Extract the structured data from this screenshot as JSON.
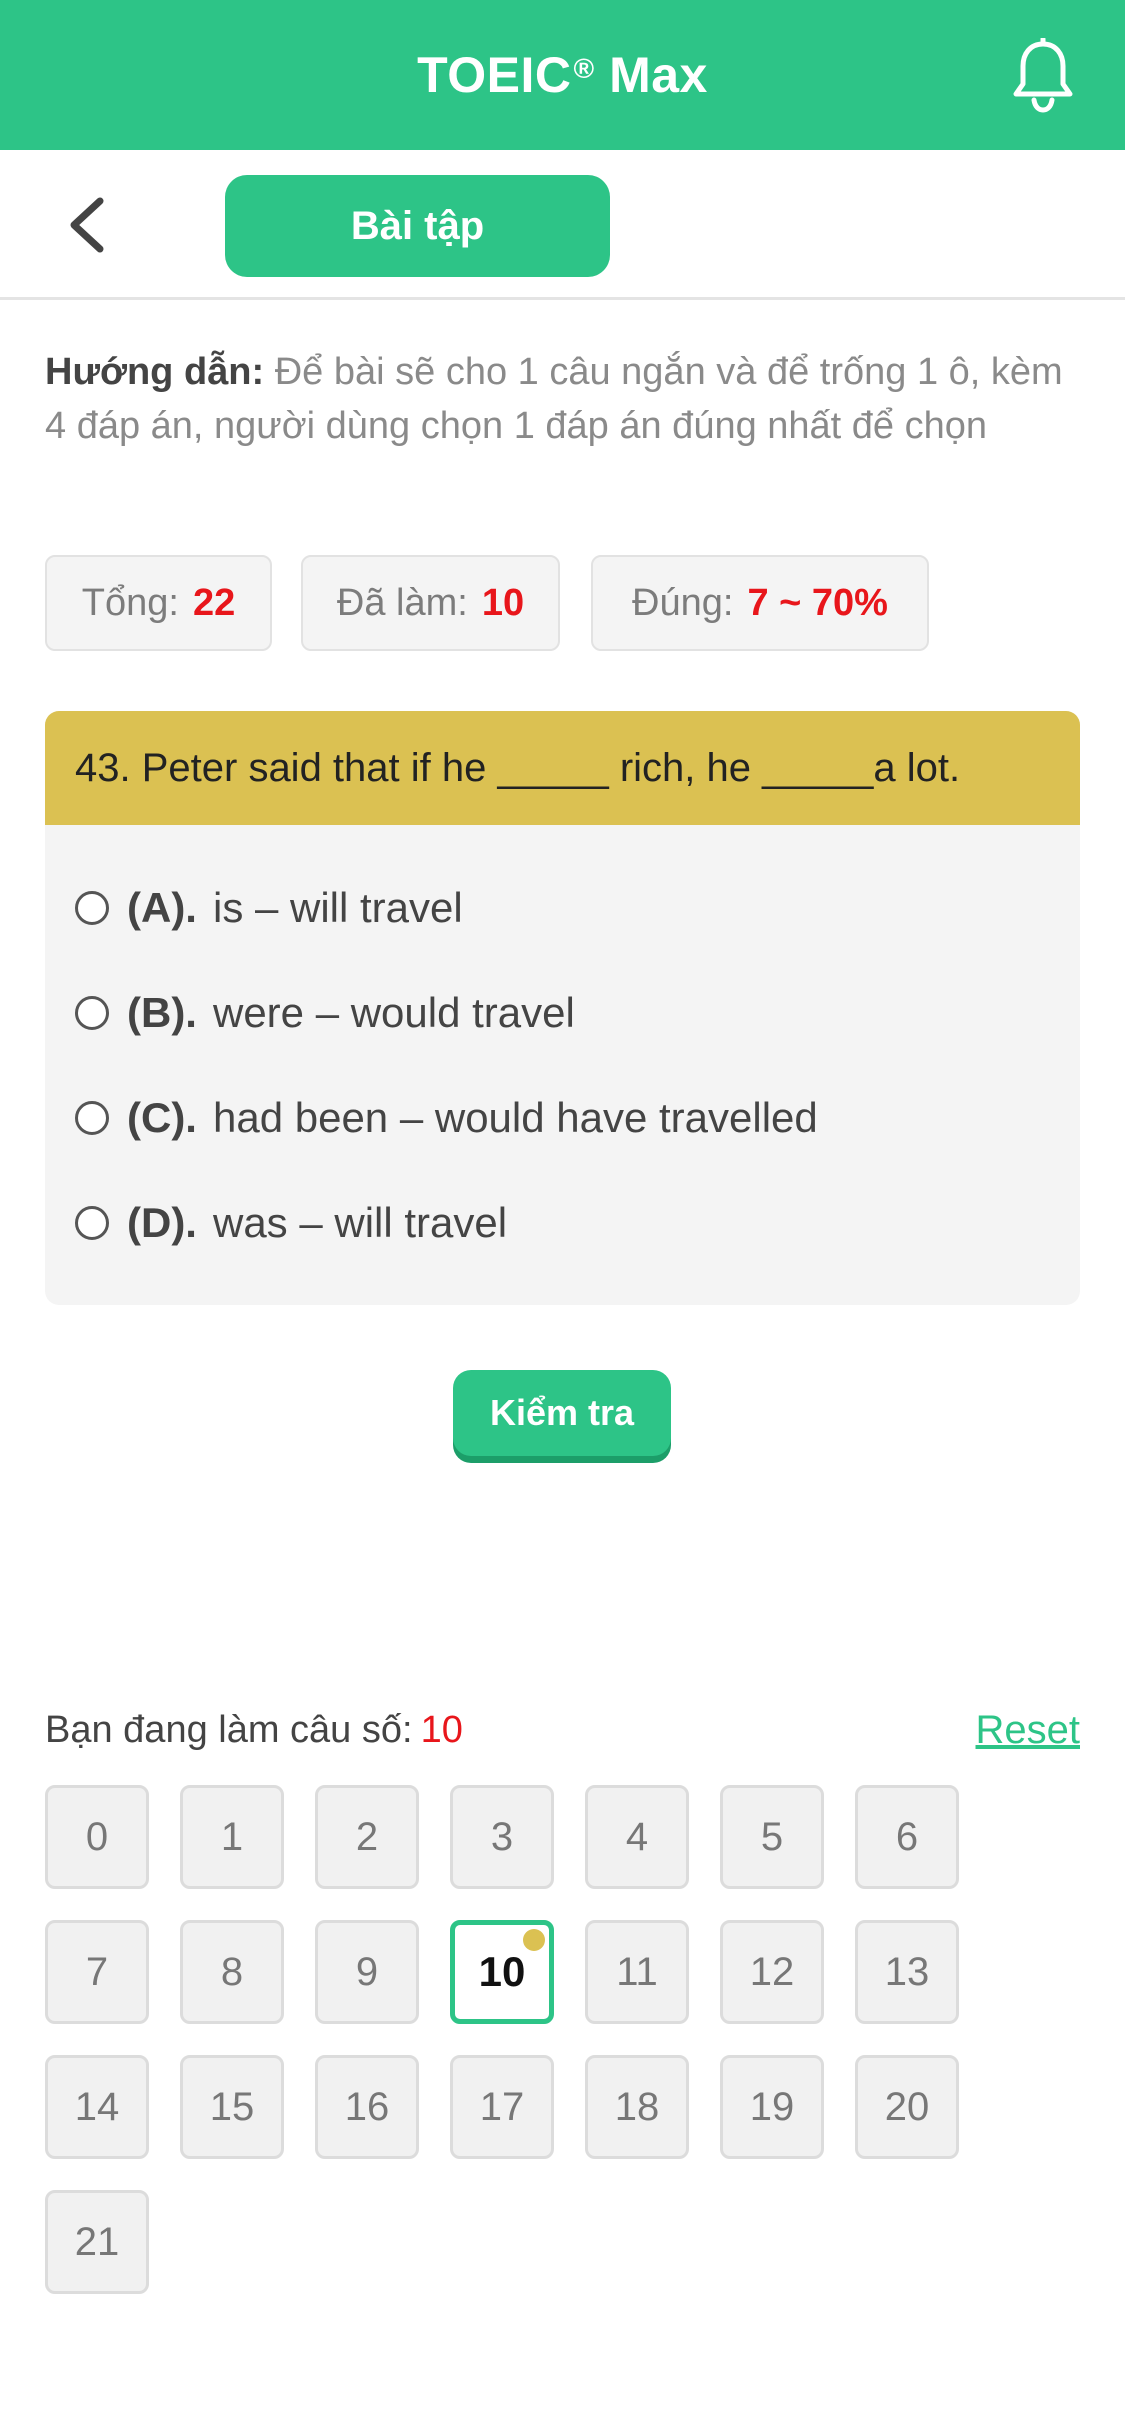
{
  "header": {
    "app_title": "TOEIC",
    "app_title_mark": "®",
    "app_title_suffix": " Max",
    "tab_label": "Bài tập"
  },
  "instructions": {
    "label": "Hướng dẫn:",
    "text": " Để bài sẽ cho 1 câu ngắn và để trống 1 ô, kèm 4 đáp án, người dùng chọn 1 đáp án đúng nhất để chọn"
  },
  "stats": {
    "total_label": "Tổng:",
    "total_value": "22",
    "done_label": "Đã làm:",
    "done_value": "10",
    "correct_label": "Đúng:",
    "correct_value": "7 ~ 70%"
  },
  "question": {
    "text": "43. Peter said that if he _____ rich, he _____a lot.",
    "options": [
      {
        "label": "(A).",
        "text": "is – will travel"
      },
      {
        "label": "(B).",
        "text": "were – would travel"
      },
      {
        "label": "(C).",
        "text": "had been – would have travelled"
      },
      {
        "label": "(D).",
        "text": "was – will travel"
      }
    ]
  },
  "check_button": "Kiểm tra",
  "progress": {
    "label": "Bạn đang làm câu số:",
    "current": "10",
    "reset_label": "Reset"
  },
  "question_numbers": [
    "0",
    "1",
    "2",
    "3",
    "4",
    "5",
    "6",
    "7",
    "8",
    "9",
    "10",
    "11",
    "12",
    "13",
    "14",
    "15",
    "16",
    "17",
    "18",
    "19",
    "20",
    "21"
  ],
  "active_question": "10",
  "colors": {
    "primary": "#2dc487",
    "question_header": "#dbc152",
    "highlight": "#e8161b"
  }
}
